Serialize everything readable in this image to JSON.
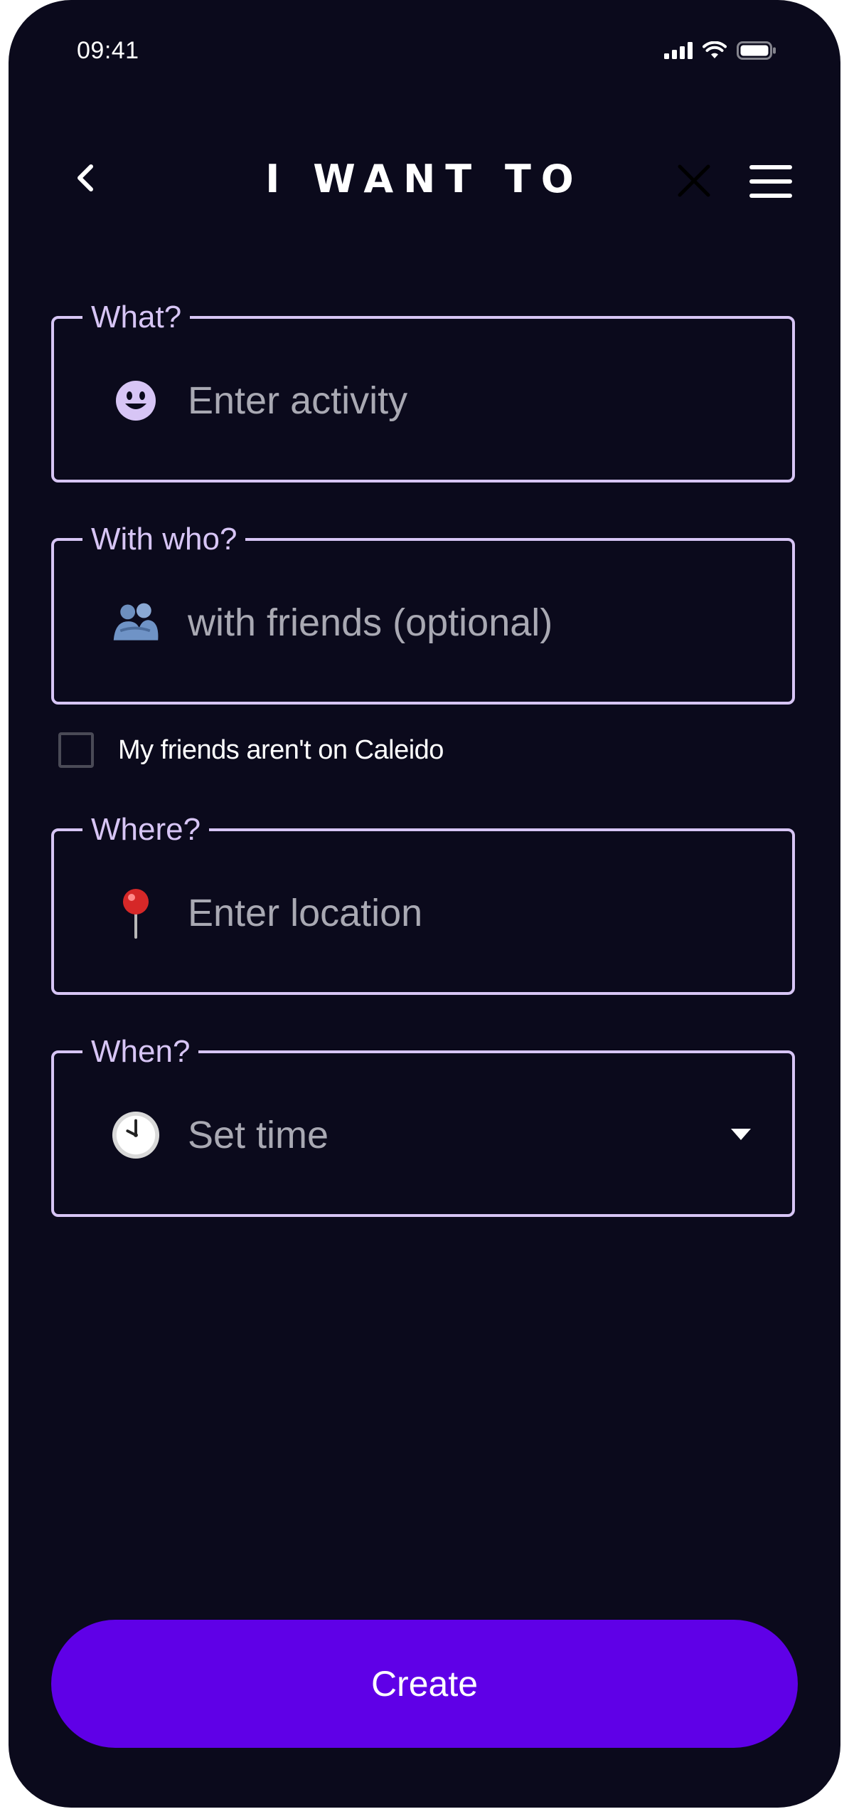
{
  "status_bar": {
    "time": "09:41",
    "icons": [
      "signal-icon",
      "wifi-icon",
      "battery-icon"
    ]
  },
  "header": {
    "title": "I WANT TO",
    "icons": [
      "back-chevron-icon",
      "close-icon",
      "menu-icon"
    ]
  },
  "form": {
    "what": {
      "label": "What?",
      "placeholder": "Enter activity",
      "icon": "smiley-face-icon"
    },
    "with_who": {
      "label": "With who?",
      "placeholder": "with friends (optional)",
      "icon": "people-hug-icon"
    },
    "not_on_app": {
      "label": "My friends aren't on Caleido",
      "checked": false
    },
    "where": {
      "label": "Where?",
      "placeholder": "Enter location",
      "icon": "pushpin-icon"
    },
    "when": {
      "label": "When?",
      "placeholder": "Set time",
      "icon": "clock-icon"
    }
  },
  "create_button": {
    "label": "Create"
  },
  "colors": {
    "background": "#0b0a1c",
    "field_border": "#d7c5f5",
    "primary": "#5f00e7",
    "placeholder": "#a9a9b3"
  }
}
